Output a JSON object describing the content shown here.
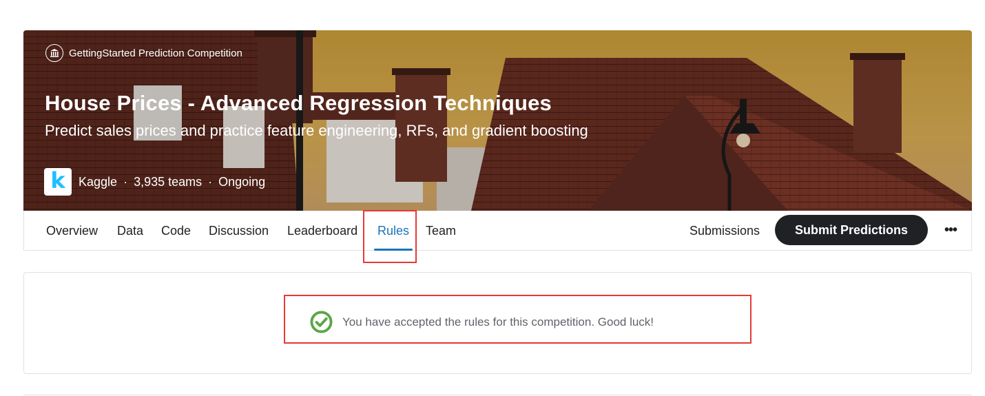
{
  "competition": {
    "tag": "GettingStarted Prediction Competition",
    "title": "House Prices - Advanced Regression Techniques",
    "subtitle": "Predict sales prices and practice feature engineering, RFs, and gradient boosting",
    "host": "Kaggle",
    "host_logo_letter": "k",
    "teams": "3,935 teams",
    "status": "Ongoing",
    "separator": "·"
  },
  "nav": {
    "tabs": [
      "Overview",
      "Data",
      "Code",
      "Discussion",
      "Leaderboard",
      "Rules",
      "Team"
    ],
    "active_tab": "Rules",
    "submissions_label": "Submissions",
    "submit_label": "Submit Predictions",
    "more_label": "•••"
  },
  "notice": {
    "message": "You have accepted the rules for this competition. Good luck!",
    "icon": "check-circle-icon"
  },
  "colors": {
    "accent": "#1a73b8",
    "highlight": "#e53935",
    "success": "#5ba646",
    "dark_button": "#202124"
  }
}
